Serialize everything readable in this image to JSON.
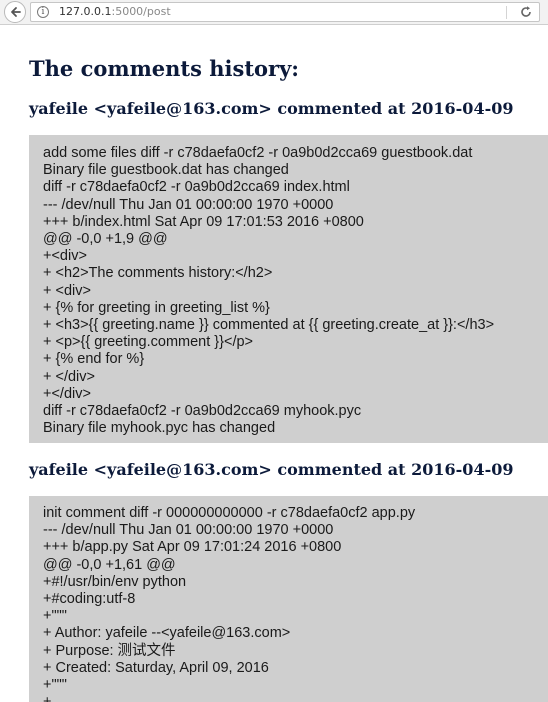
{
  "browser": {
    "url_host": "127.0.0.1",
    "url_rest": ":5000/post"
  },
  "page": {
    "title": "The comments history:"
  },
  "comments": [
    {
      "heading": "yafeile <yafeile@163.com> commented at 2016-04-09",
      "lines": [
        "add some files diff -r c78daefa0cf2 -r 0a9b0d2cca69 guestbook.dat",
        "Binary file guestbook.dat has changed",
        "diff -r c78daefa0cf2 -r 0a9b0d2cca69 index.html",
        "--- /dev/null Thu Jan 01 00:00:00 1970 +0000",
        "+++ b/index.html Sat Apr 09 17:01:53 2016 +0800",
        "@@ -0,0 +1,9 @@",
        "+<div>",
        "+ <h2>The comments history:</h2>",
        "+ <div>",
        "+ {% for greeting in greeting_list %}",
        "+ <h3>{{ greeting.name }} commented at {{ greeting.create_at }}:</h3>",
        "+ <p>{{ greeting.comment }}</p>",
        "+ {% end for %}",
        "+ </div>",
        "+</div>",
        "diff -r c78daefa0cf2 -r 0a9b0d2cca69 myhook.pyc",
        "Binary file myhook.pyc has changed"
      ]
    },
    {
      "heading": "yafeile <yafeile@163.com> commented at 2016-04-09",
      "lines": [
        "init comment diff -r 000000000000 -r c78daefa0cf2 app.py",
        "--- /dev/null Thu Jan 01 00:00:00 1970 +0000",
        "+++ b/app.py Sat Apr 09 17:01:24 2016 +0800",
        "@@ -0,0 +1,61 @@",
        "+#!/usr/bin/env python",
        "+#coding:utf-8",
        "+\"\"\"",
        "+ Author: yafeile --<yafeile@163.com>",
        "+ Purpose: 测试文件",
        "+ Created: Saturday, April 09, 2016",
        "+\"\"\"",
        "+"
      ]
    }
  ]
}
